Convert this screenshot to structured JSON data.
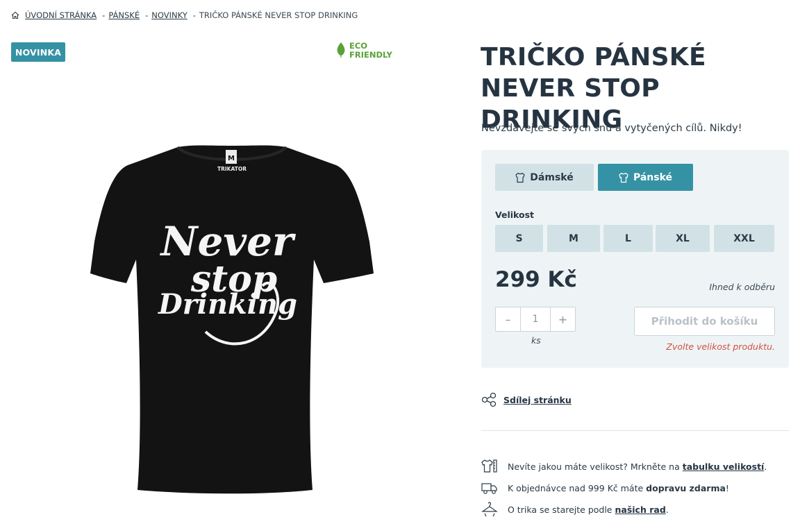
{
  "breadcrumb": {
    "home": "ÚVODNÍ STRÁNKA",
    "cat1": "PÁNSKÉ",
    "cat2": "NOVINKY",
    "current": "TRIČKO PÁNSKÉ NEVER STOP DRINKING",
    "separator": "-"
  },
  "badges": {
    "new": "NOVINKA",
    "eco_line1": "ECO",
    "eco_line2": "FRIENDLY"
  },
  "product": {
    "title": "TRIČKO PÁNSKÉ NEVER STOP DRINKING",
    "subtitle": "Nevzdávejte se svých snů a vytyčených cílů. Nikdy!",
    "tshirt_color": "#131313",
    "print_text": [
      "Never",
      "stop",
      "Drinking"
    ],
    "tag_brand": "TRIKATOR",
    "tag_letter": "M"
  },
  "variants": {
    "women": "Dámské",
    "men": "Pánské",
    "selected": "Pánské"
  },
  "sizes": {
    "label": "Velikost",
    "options": [
      "S",
      "M",
      "L",
      "XL",
      "XXL"
    ]
  },
  "pricing": {
    "price": "299 Kč",
    "stock": "Ihned k odběru"
  },
  "quantity": {
    "minus": "–",
    "value": "1",
    "plus": "+",
    "unit": "ks"
  },
  "cart": {
    "button": "Přihodit do košíku",
    "error": "Zvolte velikost produktu."
  },
  "share": {
    "label": "Sdílej stránku"
  },
  "info": {
    "size_text": "Nevíte jakou máte velikost? Mrkněte na",
    "size_link": "tabulku velikostí",
    "size_end": ".",
    "shipping_text": "K objednávce nad 999 Kč máte",
    "shipping_bold": "dopravu zdarma",
    "shipping_end": "!",
    "care_text": "O trika se starejte podle",
    "care_link": "našich rad",
    "care_end": "."
  },
  "colors": {
    "accent": "#3592a4",
    "accent_light": "#d1e1e6",
    "panel_bg": "#eef4f5",
    "eco_green": "#5ba13a",
    "error": "#d04f43",
    "heading": "#263442"
  }
}
